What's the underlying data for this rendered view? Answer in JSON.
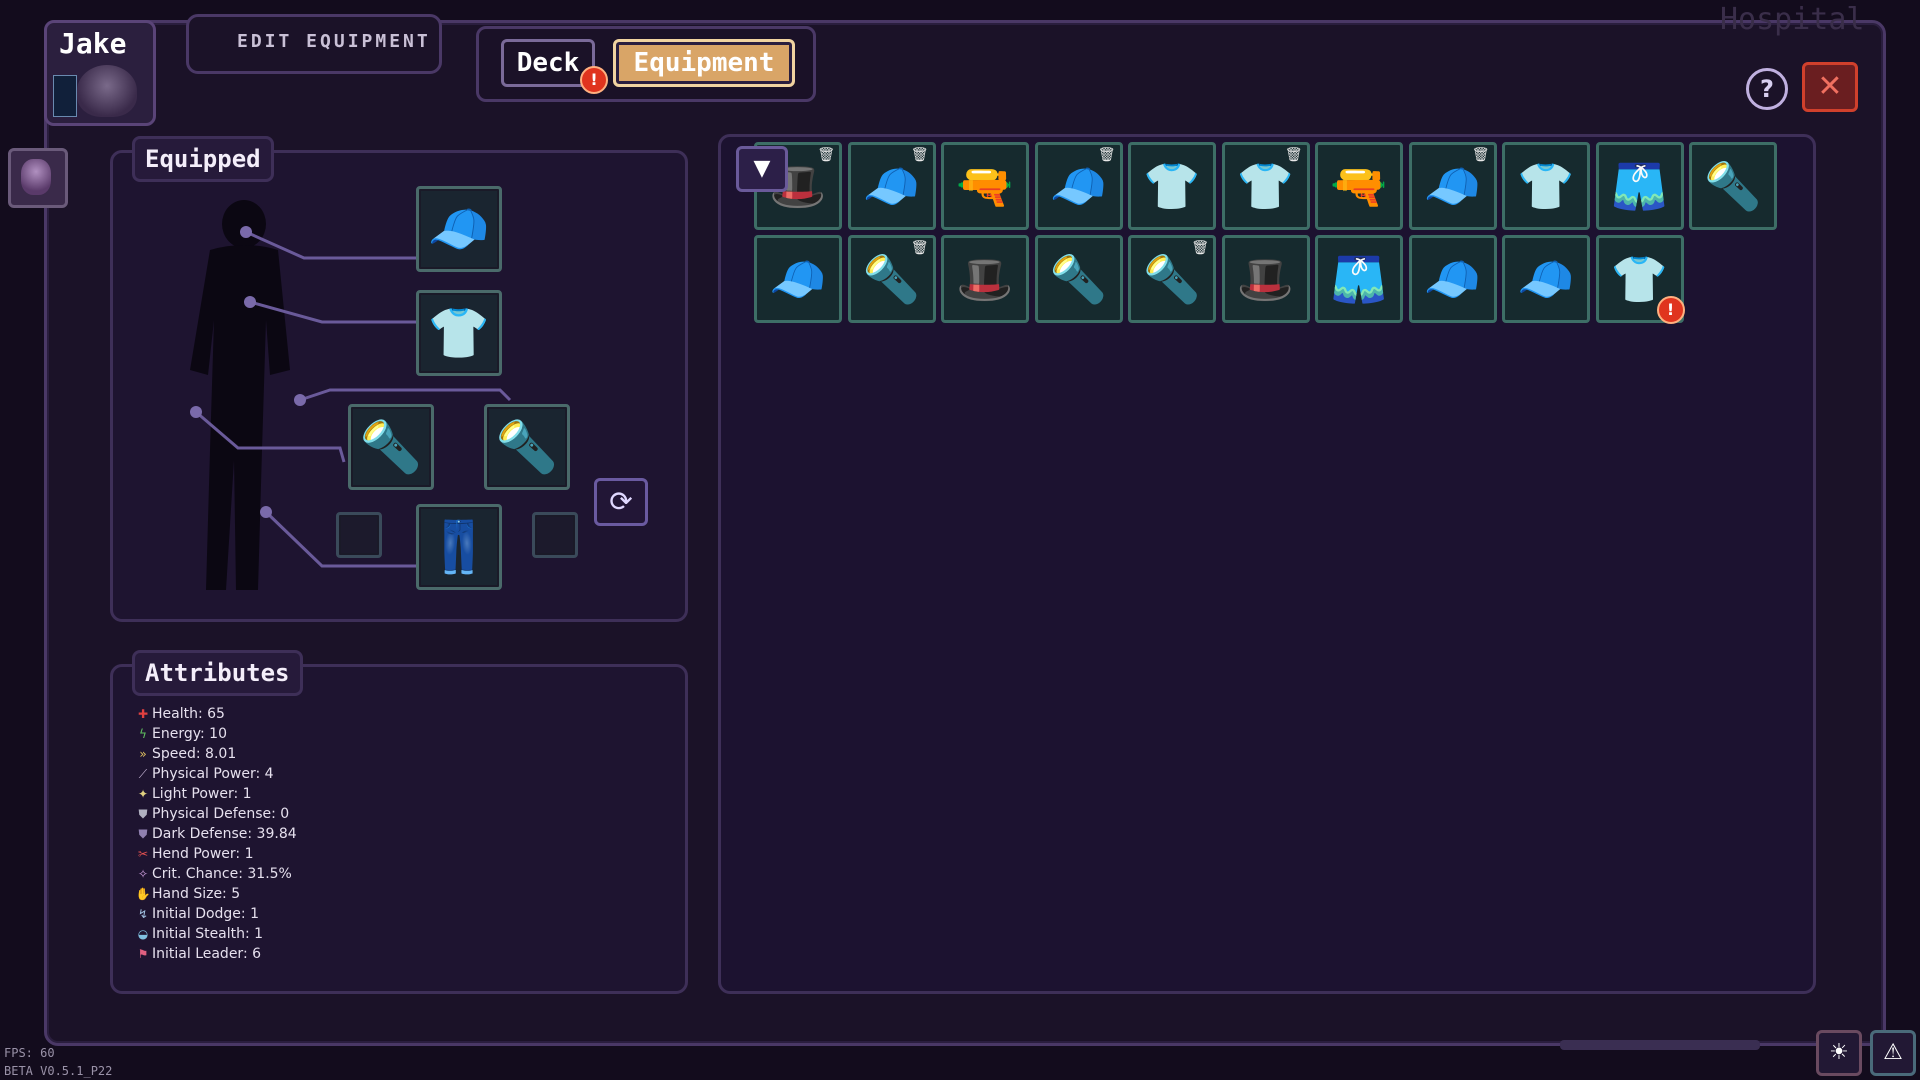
{
  "header": {
    "character_name": "Jake",
    "edit_label": "EDIT EQUIPMENT",
    "background_title": "Hospital"
  },
  "tabs": {
    "deck": "Deck",
    "equipment": "Equipment",
    "deck_alert": "!"
  },
  "controls": {
    "help": "?",
    "close": "✕",
    "filter": "▼",
    "swap": "⟳"
  },
  "equipped": {
    "title": "Equipped",
    "slots": [
      {
        "name": "head",
        "icon": "cap-icon",
        "glyph": "🧢"
      },
      {
        "name": "torso",
        "icon": "tshirt-icon",
        "glyph": "👕"
      },
      {
        "name": "left-hand",
        "icon": "flashlight-icon",
        "glyph": "🔦"
      },
      {
        "name": "right-hand",
        "icon": "flashlight-icon",
        "glyph": "🔦"
      },
      {
        "name": "legs",
        "icon": "jeans-icon",
        "glyph": "👖"
      }
    ]
  },
  "attributes": {
    "title": "Attributes",
    "items": [
      {
        "label": "Health: 65",
        "icon": "health-icon",
        "glyph": "✚",
        "color": "#e04040"
      },
      {
        "label": "Energy: 10",
        "icon": "energy-icon",
        "glyph": "ϟ",
        "color": "#60c060"
      },
      {
        "label": "Speed: 8.01",
        "icon": "speed-icon",
        "glyph": "»",
        "color": "#e0c060"
      },
      {
        "label": "Physical Power: 4",
        "icon": "physical-power-icon",
        "glyph": "⟋",
        "color": "#c0b0d0"
      },
      {
        "label": "Light Power: 1",
        "icon": "light-power-icon",
        "glyph": "✦",
        "color": "#e0d080"
      },
      {
        "label": "Physical Defense: 0",
        "icon": "physical-defense-icon",
        "glyph": "⛊",
        "color": "#b0b0c0"
      },
      {
        "label": "Dark Defense: 39.84",
        "icon": "dark-defense-icon",
        "glyph": "⛊",
        "color": "#9080b0"
      },
      {
        "label": "Hend Power: 1",
        "icon": "hend-power-icon",
        "glyph": "✂",
        "color": "#e05050"
      },
      {
        "label": "Crit. Chance: 31.5%",
        "icon": "crit-chance-icon",
        "glyph": "✧",
        "color": "#d0a0e0"
      },
      {
        "label": "Hand Size: 5",
        "icon": "hand-size-icon",
        "glyph": "✋",
        "color": "#e0c090"
      },
      {
        "label": "Initial Dodge: 1",
        "icon": "dodge-icon",
        "glyph": "↯",
        "color": "#a0c0e0"
      },
      {
        "label": "Initial Stealth: 1",
        "icon": "stealth-icon",
        "glyph": "◒",
        "color": "#80c0e0"
      },
      {
        "label": "Initial Leader: 6",
        "icon": "leader-icon",
        "glyph": "⚑",
        "color": "#e06080"
      }
    ]
  },
  "inventory": {
    "items": [
      {
        "icon": "fedora-hat-icon",
        "glyph": "🎩",
        "trash": true
      },
      {
        "icon": "orange-cap-icon",
        "glyph": "🧢",
        "trash": true
      },
      {
        "icon": "revolver-icon",
        "glyph": "🔫",
        "trash": false
      },
      {
        "icon": "blue-cap-icon",
        "glyph": "🧢",
        "trash": true
      },
      {
        "icon": "white-tshirt-icon",
        "glyph": "👕",
        "trash": false
      },
      {
        "icon": "yellow-polo-icon",
        "glyph": "👕",
        "trash": true
      },
      {
        "icon": "pistol-icon",
        "glyph": "🔫",
        "trash": false
      },
      {
        "icon": "orange-cap-icon",
        "glyph": "🧢",
        "trash": true
      },
      {
        "icon": "green-polo-icon",
        "glyph": "👕",
        "trash": false
      },
      {
        "icon": "black-shorts-icon",
        "glyph": "🩳",
        "trash": false
      },
      {
        "icon": "yellow-flashlight-icon",
        "glyph": "🔦",
        "trash": false
      },
      {
        "icon": "blue-cap-icon",
        "glyph": "🧢",
        "trash": false
      },
      {
        "icon": "red-flashlight-icon",
        "glyph": "🔦",
        "trash": true
      },
      {
        "icon": "fedora-hat-icon",
        "glyph": "🎩",
        "trash": false
      },
      {
        "icon": "red-flashlight-icon",
        "glyph": "🔦",
        "trash": false
      },
      {
        "icon": "red-flashlight-icon",
        "glyph": "🔦",
        "trash": true
      },
      {
        "icon": "fedora-hat-icon",
        "glyph": "🎩",
        "trash": false
      },
      {
        "icon": "black-shorts-icon",
        "glyph": "🩳",
        "trash": false
      },
      {
        "icon": "blue-cap-icon",
        "glyph": "🧢",
        "trash": false
      },
      {
        "icon": "blue-cap-icon",
        "glyph": "🧢",
        "trash": false
      },
      {
        "icon": "blue-polo-icon",
        "glyph": "👕",
        "trash": false,
        "alert": true
      }
    ]
  },
  "footer": {
    "fps": "FPS: 60",
    "version": "BETA V0.5.1_P22"
  },
  "colors": {
    "accent": "#d9a567",
    "panel_border": "#3e2f58",
    "alert": "#e0341e",
    "slot_border": "#3d6e66"
  }
}
